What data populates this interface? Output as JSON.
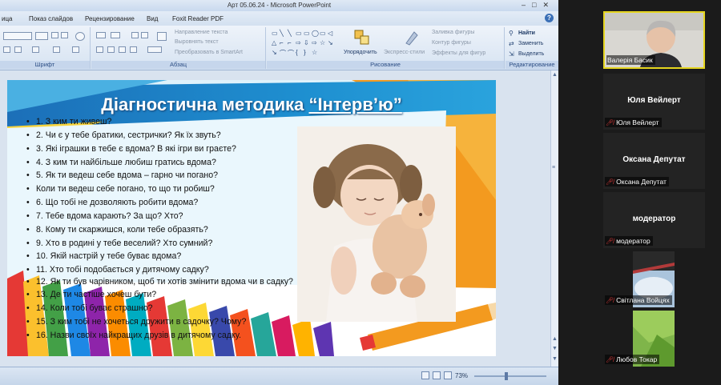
{
  "window": {
    "title": "Арт 05.06.24 - Microsoft PowerPoint",
    "controls": [
      "–",
      "□",
      "✕"
    ]
  },
  "menu": {
    "items": [
      "ица",
      "Показ слайдов",
      "Рецензирование",
      "Вид",
      "Foxit Reader PDF"
    ],
    "help": "?"
  },
  "ribbon": {
    "groups": {
      "font": "Шрифт",
      "paragraph": "Абзац",
      "drawing": "Рисование",
      "editing": "Редактирование"
    },
    "paragraph_items": [
      "Направление текста",
      "Выровнять текст",
      "Преобразовать в SmartArt"
    ],
    "arrange": "Упорядочить",
    "quick_styles": "Экспресс-стили",
    "shape_fill": "Заливка фигуры",
    "shape_outline": "Контур фигуры",
    "shape_effects": "Эффекты для фигур",
    "find": "Найти",
    "replace": "Заменить",
    "select": "Выделить",
    "font_size_value": "",
    "shapes_glyphs": [
      "▭",
      "╲",
      "╲",
      "▭",
      "▭",
      "◯",
      "▭",
      "◁",
      "△",
      "⌐",
      "⌐",
      "⇨",
      "⇩",
      "⇨",
      "☆",
      "↘",
      "↘",
      "⌒",
      "⌒",
      "{",
      "}",
      "☆"
    ]
  },
  "slide": {
    "title_part1": "Діагностична методика ",
    "title_part2": "“Інтерв’ю”",
    "questions": [
      "1. З ким ти живеш?",
      "2. Чи є у тебе братики, сестрички?  Як їх звуть?",
      "3. Які іграшки в тебе є вдома? В які ігри ви граєте?",
      "4. З ким ти найбільше любиш гратись вдома?",
      "5. Як ти ведеш себе вдома – гарно чи погано?",
      "Коли ти ведеш себе погано, то що ти робиш?",
      "6. Що тобі не дозволяють робити вдома?",
      "7. Тебе вдома карають? За що? Хто?",
      "8. Кому ти скаржишся, коли тебе образять?",
      "9. Хто в родині у тебе веселий? Хто сумний?",
      "10. Якій настрій у тебе буває вдома?",
      "11. Хто тобі подобається  у дитячому садку?",
      "12. Як ти був чарівником,  щоб ти хотів змінити  вдома чи в садку?",
      "13. Де ти частіше хочеш бути?",
      "14. Коли тобі буває страшно?",
      "15. З ким тобі не хочеться дружити в садочку? Чому?",
      "16. Назви своїх найкращих друзів в дитячому садку."
    ]
  },
  "statusbar": {
    "zoom": "73%"
  },
  "participants": [
    {
      "name_big": "",
      "label": "Валерія Басик",
      "muted": false
    },
    {
      "name_big": "Юля Вейлерт",
      "label": "Юля Вейлерт",
      "muted": true
    },
    {
      "name_big": "Оксана Депутат",
      "label": "Оксана Депутат",
      "muted": true
    },
    {
      "name_big": "модератор",
      "label": "модератор",
      "muted": true
    },
    {
      "name_big": "",
      "label": "Світлана Войцях",
      "muted": true
    },
    {
      "name_big": "",
      "label": "Любов Токар",
      "muted": true
    }
  ],
  "colors": {
    "active_speaker_border": "#e5d51f",
    "muted_icon": "#e03a3a",
    "slide_title_band": "#1e88c9"
  }
}
